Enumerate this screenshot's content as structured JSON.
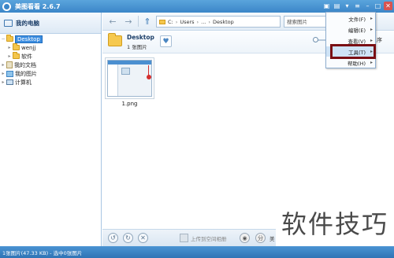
{
  "window": {
    "title": "美图看看 2.6.7"
  },
  "sidebar": {
    "header": "我的电脑",
    "tree": [
      {
        "label": "Desktop",
        "selected": true,
        "icon": "folder-icon"
      },
      {
        "label": "wenjj",
        "icon": "folder-icon"
      },
      {
        "label": "软件",
        "icon": "folder-icon"
      },
      {
        "label": "我的文档",
        "icon": "document-icon"
      },
      {
        "label": "我的图片",
        "icon": "pictures-icon"
      },
      {
        "label": "计算机",
        "icon": "computer-icon"
      }
    ]
  },
  "toolbar": {
    "address": [
      "C:",
      "Users",
      "...",
      "Desktop"
    ],
    "search_placeholder": "搜索图片"
  },
  "folder": {
    "name": "Desktop",
    "count": "1 张图片",
    "sort_fragment": "序"
  },
  "content": {
    "files": [
      {
        "name": "1.png"
      }
    ]
  },
  "bottombar": {
    "upload_label": "上传到空间相册",
    "share_icon_text": "分",
    "share_label": "美"
  },
  "status": {
    "text": "1张图片(47.33 KB) - 选中0张图片"
  },
  "menu": {
    "items": [
      "文件(F)",
      "编辑(E)",
      "查看(V)",
      "工具(T)",
      "帮助(H)"
    ],
    "highlighted": "工具(T)"
  },
  "watermark": "软件技巧",
  "colors": {
    "accent": "#3b86c8",
    "highlight_box": "#7a0f14"
  }
}
